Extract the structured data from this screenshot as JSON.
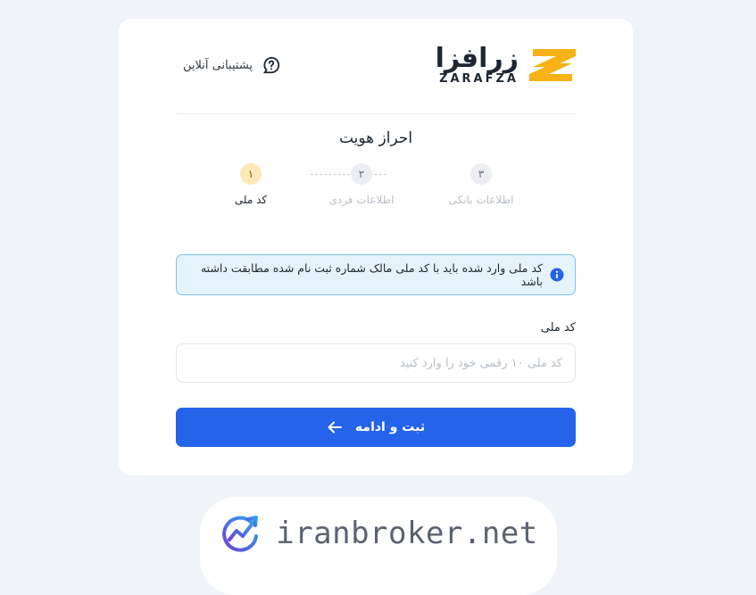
{
  "header": {
    "support_label": "پشتیبانی آنلاین",
    "logo_fa": "زرافزا",
    "logo_en": "ZARAFZA"
  },
  "page": {
    "title": "احراز هویت"
  },
  "steps": [
    {
      "number": "۱",
      "label": "کد ملی",
      "active": true
    },
    {
      "number": "۲",
      "label": "اطلاعات فردی",
      "active": false
    },
    {
      "number": "۳",
      "label": "اطلاعات بانکی",
      "active": false
    }
  ],
  "alert": {
    "text": "کد ملی وارد شده باید با کد ملی مالک شماره ثبت نام شده مطابقت داشته باشد"
  },
  "form": {
    "national_code_label": "کد ملی",
    "national_code_placeholder": "کد ملی ۱۰ رقمی خود را وارد کنید",
    "national_code_value": "",
    "submit_label": "ثبت و ادامه"
  },
  "watermark": {
    "text": "iranbroker.net"
  },
  "colors": {
    "primary": "#2563eb",
    "logo_accent": "#f6b216",
    "active_step": "#fde9b8",
    "alert_bg": "#e4f3fc",
    "alert_border": "#7cc3f0"
  },
  "icons": {
    "support": "question-chat-icon",
    "info": "info-icon",
    "submit": "arrow-left-icon",
    "brand": "chart-growth-icon"
  }
}
